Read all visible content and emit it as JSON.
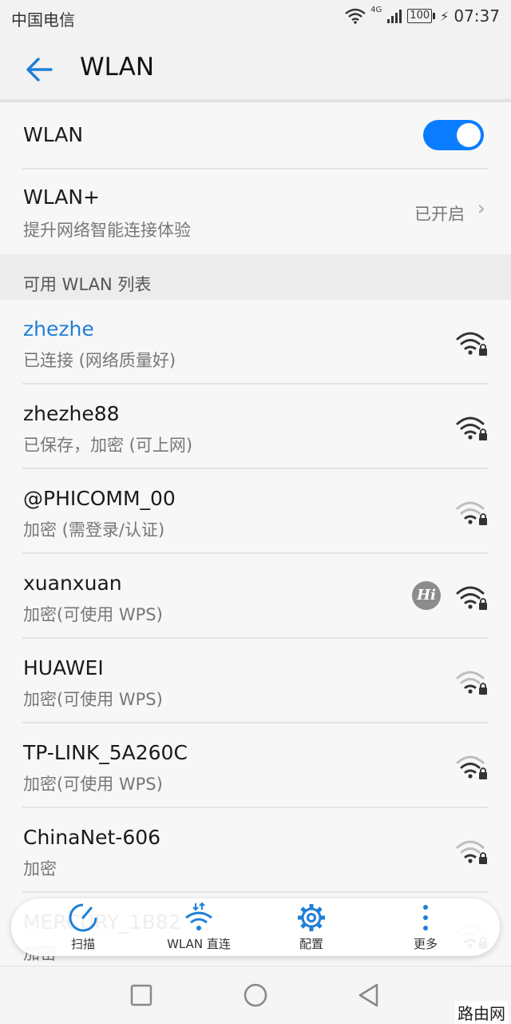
{
  "status_bar": {
    "carrier": "中国电信",
    "network_type": "4G",
    "battery": "100",
    "time": "07:37"
  },
  "header": {
    "title": "WLAN"
  },
  "wlan_switch": {
    "label": "WLAN",
    "enabled": true
  },
  "wlan_plus": {
    "title": "WLAN+",
    "subtitle": "提升网络智能连接体验",
    "value": "已开启"
  },
  "available_section": {
    "title": "可用 WLAN 列表"
  },
  "networks": [
    {
      "name": "zhezhe",
      "status": "已连接 (网络质量好)",
      "connected": true,
      "signal": "strong",
      "secured": true
    },
    {
      "name": "zhezhe88",
      "status": "已保存，加密 (可上网)",
      "connected": false,
      "signal": "strong",
      "secured": true
    },
    {
      "name": "@PHICOMM_00",
      "status": "加密 (需登录/认证)",
      "connected": false,
      "signal": "weak",
      "secured": true
    },
    {
      "name": "xuanxuan",
      "status": "加密(可使用 WPS)",
      "connected": false,
      "signal": "strong",
      "secured": true,
      "badge": "Hi"
    },
    {
      "name": "HUAWEI",
      "status": "加密(可使用 WPS)",
      "connected": false,
      "signal": "weak",
      "secured": true
    },
    {
      "name": "TP-LINK_5A260C",
      "status": "加密(可使用 WPS)",
      "connected": false,
      "signal": "medium",
      "secured": true
    },
    {
      "name": "ChinaNet-606",
      "status": "加密",
      "connected": false,
      "signal": "weak",
      "secured": true
    },
    {
      "name": "MERCURY_1B82",
      "status": "加密",
      "connected": false,
      "signal": "weak",
      "secured": true
    }
  ],
  "actions": {
    "scan": "扫描",
    "direct": "WLAN 直连",
    "config": "配置",
    "more": "更多"
  },
  "watermark": "路由网",
  "colors": {
    "accent": "#0a7cff",
    "connected_text": "#1f7fd8",
    "background": "#f2f2f2"
  }
}
